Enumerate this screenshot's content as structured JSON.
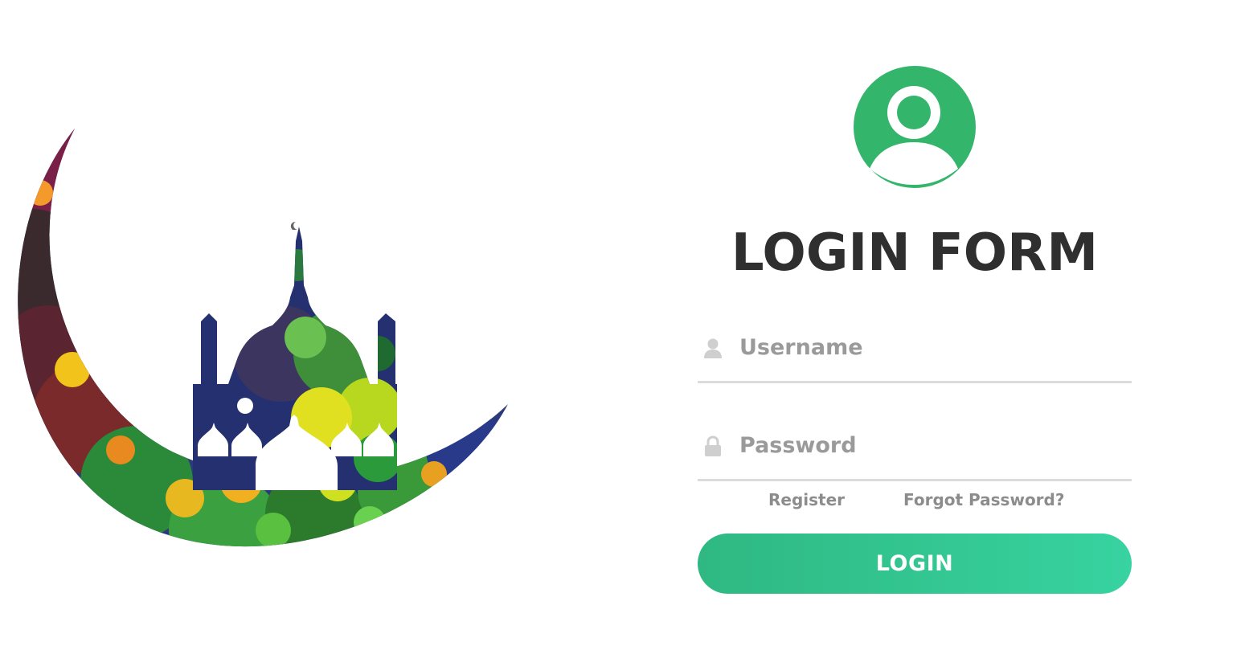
{
  "form": {
    "title": "LOGIN FORM",
    "username": {
      "placeholder": "Username",
      "value": ""
    },
    "password": {
      "placeholder": "Password",
      "value": ""
    },
    "register_label": "Register",
    "forgot_label": "Forgot Password?",
    "login_label": "LOGIN"
  },
  "colors": {
    "accent": "#34b56c",
    "button_gradient_start": "#2fb882",
    "button_gradient_end": "#37d3a0",
    "title": "#2f2f2f",
    "muted": "#9a9a9a"
  },
  "icons": {
    "avatar": "user-avatar-icon",
    "username": "user-icon",
    "password": "lock-icon"
  }
}
